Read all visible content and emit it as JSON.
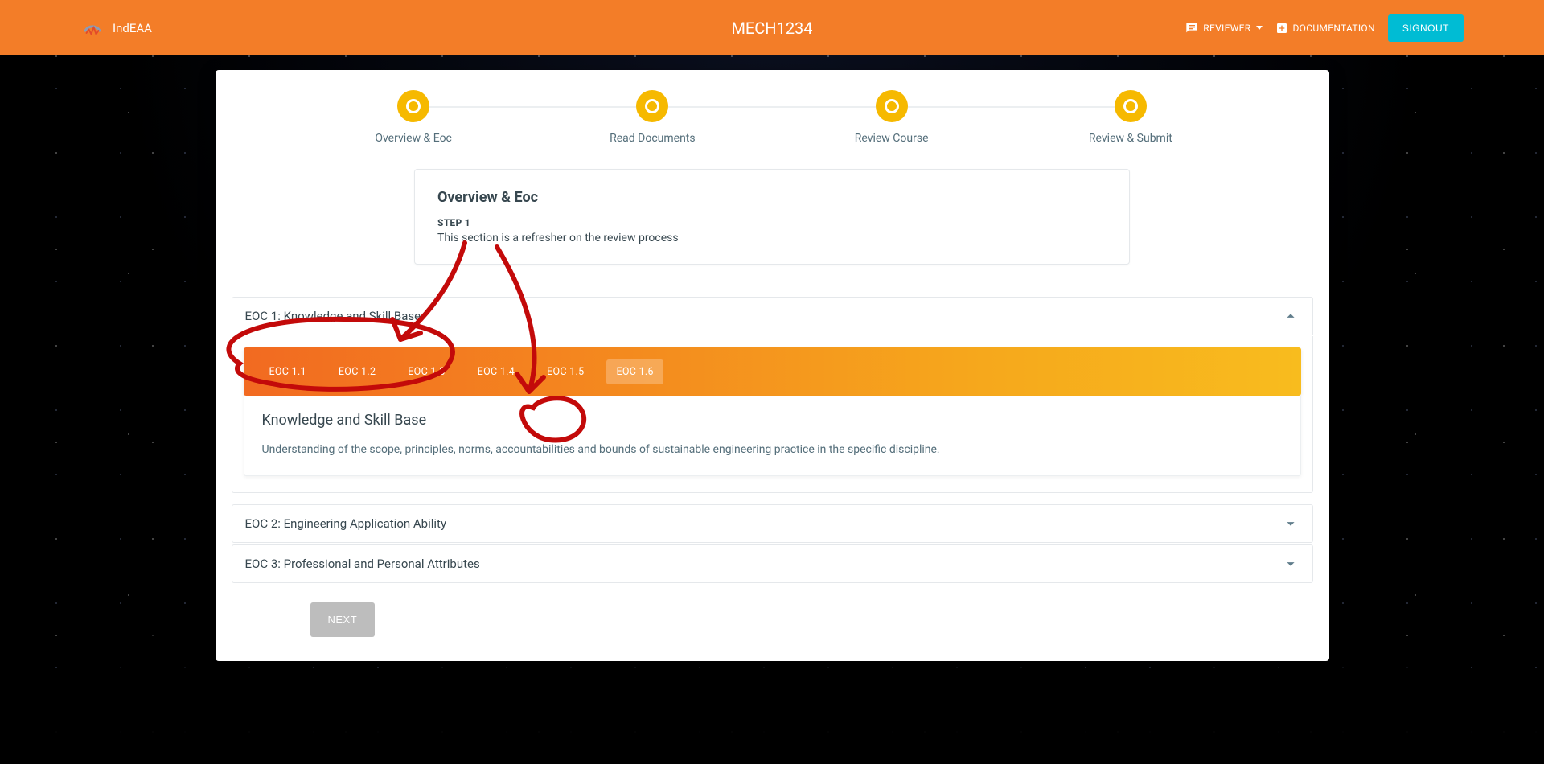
{
  "header": {
    "brand": "IndEAA",
    "title": "MECH1234",
    "reviewer": "REVIEWER",
    "documentation": "DOCUMENTATION",
    "signout": "SIGNOUT"
  },
  "stepper": {
    "s1": "Overview & Eoc",
    "s2": "Read Documents",
    "s3": "Review Course",
    "s4": "Review & Submit"
  },
  "overview": {
    "title": "Overview & Eoc",
    "step": "STEP 1",
    "desc": "This section is a refresher on the review process"
  },
  "eoc1": {
    "header": "EOC 1: Knowledge and Skill Base",
    "tabs": {
      "t1": "EOC 1.1",
      "t2": "EOC 1.2",
      "t3": "EOC 1.3",
      "t4": "EOC 1.4",
      "t5": "EOC 1.5",
      "t6": "EOC 1.6"
    },
    "content_title": "Knowledge and Skill Base",
    "content_desc": "Understanding of the scope, principles, norms, accountabilities and bounds of sustainable engineering practice in the specific discipline."
  },
  "eoc2": {
    "header": "EOC 2: Engineering Application Ability"
  },
  "eoc3": {
    "header": "EOC 3: Professional and Personal Attributes"
  },
  "buttons": {
    "next": "NEXT"
  }
}
